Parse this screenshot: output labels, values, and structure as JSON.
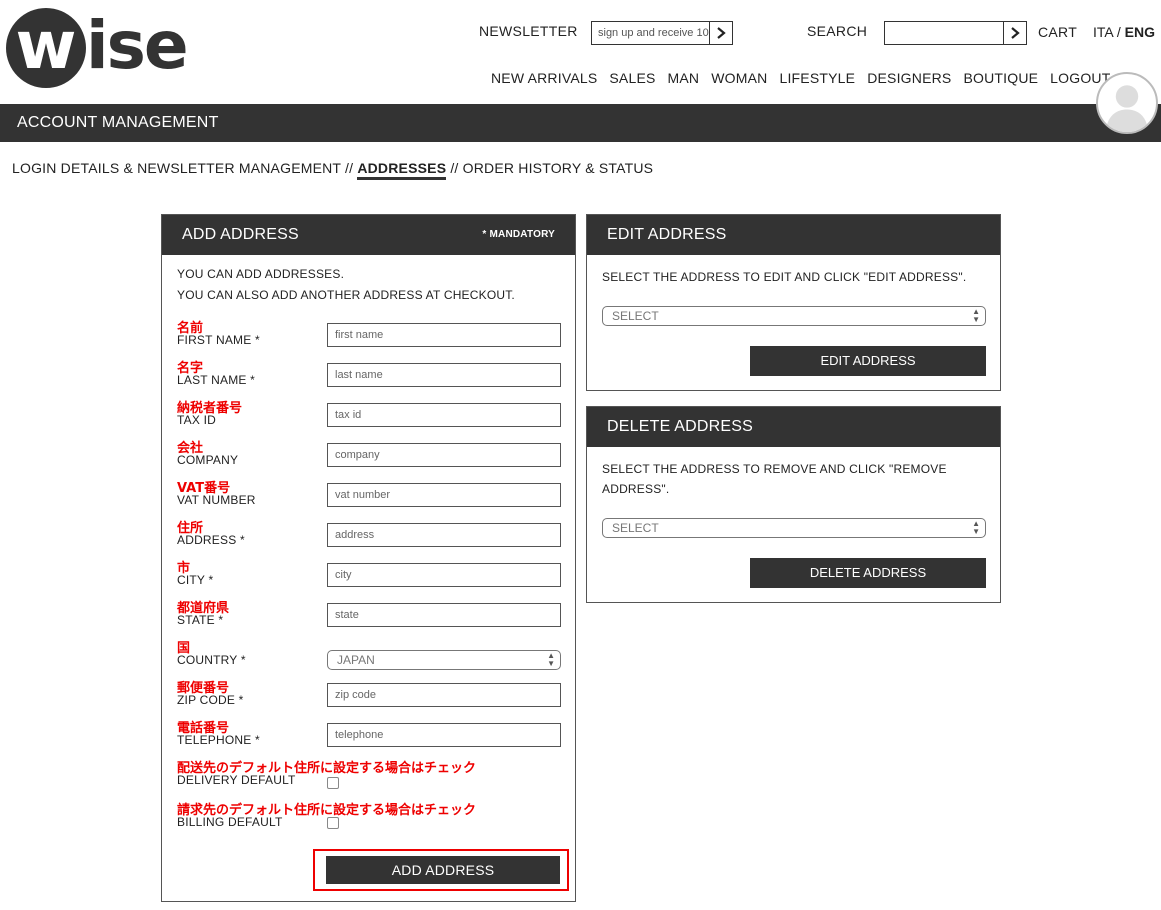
{
  "logo": {
    "letter": "w",
    "rest": "ise"
  },
  "header": {
    "newsletter_label": "NEWSLETTER",
    "newsletter_placeholder": "sign up and receive 10",
    "search_label": "SEARCH",
    "cart_label": "CART",
    "lang_ita": "ITA",
    "lang_sep": "/",
    "lang_eng": "ENG"
  },
  "nav": {
    "items": [
      "NEW ARRIVALS",
      "SALES",
      "MAN",
      "WOMAN",
      "LIFESTYLE",
      "DESIGNERS",
      "BOUTIQUE",
      "LOGOUT"
    ]
  },
  "account_bar": {
    "title": "ACCOUNT MANAGEMENT"
  },
  "subnav": {
    "login": "LOGIN DETAILS & NEWSLETTER MANAGEMENT",
    "sep": "//",
    "addresses": "ADDRESSES",
    "orders": "ORDER HISTORY & STATUS"
  },
  "add_panel": {
    "title": "ADD ADDRESS",
    "mandatory": "* MANDATORY",
    "intro1": "YOU CAN ADD ADDRESSES.",
    "intro2": "YOU CAN ALSO ADD ANOTHER ADDRESS AT CHECKOUT.",
    "fields": [
      {
        "jp": "名前",
        "label": "FIRST NAME *",
        "placeholder": "first name"
      },
      {
        "jp": "名字",
        "label": "LAST NAME *",
        "placeholder": "last name"
      },
      {
        "jp": "納税者番号",
        "label": "TAX ID",
        "placeholder": "tax id"
      },
      {
        "jp": "会社",
        "label": "COMPANY",
        "placeholder": "company"
      },
      {
        "jp": "VAT番号",
        "label": "VAT NUMBER",
        "placeholder": "vat number"
      },
      {
        "jp": "住所",
        "label": "ADDRESS *",
        "placeholder": "address"
      },
      {
        "jp": "市",
        "label": "CITY *",
        "placeholder": "city"
      },
      {
        "jp": "都道府県",
        "label": "STATE *",
        "placeholder": "state"
      },
      {
        "jp": "国",
        "label": "COUNTRY *",
        "value": "JAPAN"
      },
      {
        "jp": "郵便番号",
        "label": "ZIP CODE *",
        "placeholder": "zip code"
      },
      {
        "jp": "電話番号",
        "label": "TELEPHONE *",
        "placeholder": "telephone"
      },
      {
        "jp": "配送先のデフォルト住所に設定する場合はチェック",
        "label": "DELIVERY DEFAULT"
      },
      {
        "jp": "請求先のデフォルト住所に設定する場合はチェック",
        "label": "BILLING DEFAULT"
      }
    ],
    "button": "ADD ADDRESS"
  },
  "edit_panel": {
    "title": "EDIT ADDRESS",
    "text": "SELECT THE ADDRESS TO EDIT AND CLICK \"EDIT ADDRESS\".",
    "select": "SELECT",
    "button": "EDIT ADDRESS"
  },
  "delete_panel": {
    "title": "DELETE ADDRESS",
    "text": "SELECT THE ADDRESS TO REMOVE AND CLICK \"REMOVE ADDRESS\".",
    "select": "SELECT",
    "button": "DELETE ADDRESS"
  },
  "colors": {
    "dark": "#333333",
    "accent_red": "#e00000"
  }
}
